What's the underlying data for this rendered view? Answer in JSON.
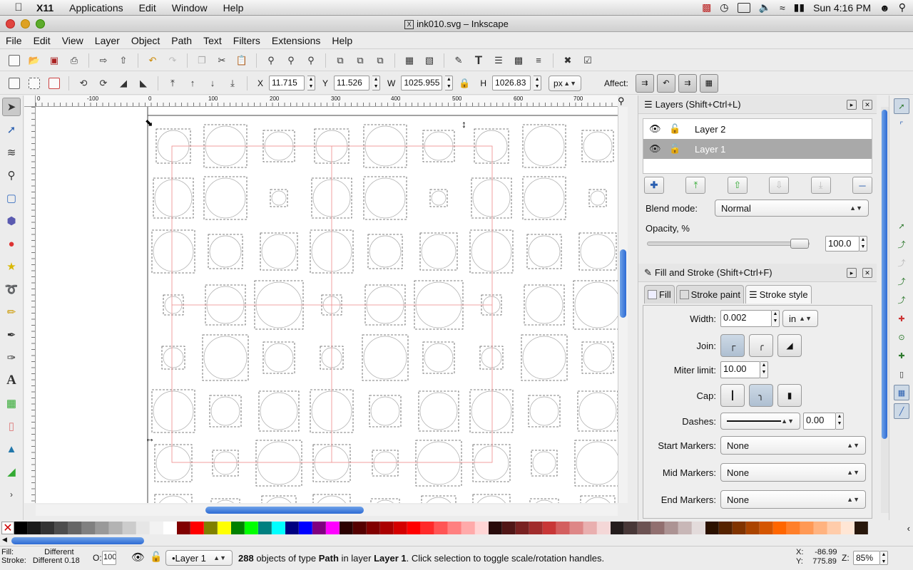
{
  "macbar": {
    "app": "X11",
    "menus": [
      "Applications",
      "Edit",
      "Window",
      "Help"
    ],
    "clock": "Sun 4:16 PM"
  },
  "window": {
    "title": "ink010.svg – Inkscape"
  },
  "menu": [
    "File",
    "Edit",
    "View",
    "Layer",
    "Object",
    "Path",
    "Text",
    "Filters",
    "Extensions",
    "Help"
  ],
  "controls": {
    "x_label": "X",
    "x": "11.715",
    "y_label": "Y",
    "y": "11.526",
    "w_label": "W",
    "w": "1025.955",
    "h_label": "H",
    "h": "1026.83",
    "unit": "px",
    "affect_label": "Affect:"
  },
  "ruler": {
    "h_ticks": [
      "0",
      "-100",
      "0",
      "100",
      "200",
      "300",
      "400",
      "500",
      "600",
      "700"
    ]
  },
  "layers_panel": {
    "title": "Layers (Shift+Ctrl+L)",
    "layers": [
      {
        "name": "Layer 2",
        "selected": false
      },
      {
        "name": "Layer 1",
        "selected": true
      }
    ],
    "blend_label": "Blend mode:",
    "blend_value": "Normal",
    "opacity_label": "Opacity, %",
    "opacity_value": "100.0",
    "opacity_level": 1.0
  },
  "fill_stroke": {
    "title": "Fill and Stroke (Shift+Ctrl+F)",
    "tabs": [
      "Fill",
      "Stroke paint",
      "Stroke style"
    ],
    "active_tab": "Stroke style",
    "width_label": "Width:",
    "width": "0.002",
    "width_unit": "in",
    "join_label": "Join:",
    "miter_label": "Miter limit:",
    "miter": "10.00",
    "cap_label": "Cap:",
    "dashes_label": "Dashes:",
    "dash_offset": "0.00",
    "start_markers_label": "Start Markers:",
    "start_markers": "None",
    "mid_markers_label": "Mid Markers:",
    "mid_markers": "None",
    "end_markers_label": "End Markers:",
    "end_markers": "None"
  },
  "palette": [
    "#000000",
    "#1a1a1a",
    "#333333",
    "#4d4d4d",
    "#666666",
    "#808080",
    "#999999",
    "#b3b3b3",
    "#cccccc",
    "#e6e6e6",
    "#f2f2f2",
    "#ffffff",
    "#800000",
    "#ff0000",
    "#808000",
    "#ffff00",
    "#008000",
    "#00ff00",
    "#008080",
    "#00ffff",
    "#000080",
    "#0000ff",
    "#800080",
    "#ff00ff",
    "#2b0000",
    "#550000",
    "#800000",
    "#aa0000",
    "#d40000",
    "#ff0000",
    "#ff2a2a",
    "#ff5555",
    "#ff8080",
    "#ffaaaa",
    "#ffd5d5",
    "#280b0b",
    "#501616",
    "#782121",
    "#a02c2c",
    "#c83737",
    "#d35f5f",
    "#de8787",
    "#e9afaf",
    "#f4d7d7",
    "#241c1c",
    "#483737",
    "#6c5353",
    "#916f6f",
    "#ac9393",
    "#c8b7b7",
    "#e3dbdb",
    "#2b1100",
    "#552200",
    "#803300",
    "#aa4400",
    "#d45500",
    "#ff6600",
    "#ff7f2a",
    "#ff9955",
    "#ffb380",
    "#ffccaa",
    "#ffe6d5",
    "#28170b"
  ],
  "status": {
    "fill_label": "Fill:",
    "fill_value": "Different",
    "stroke_label": "Stroke:",
    "stroke_value": "Different 0.18",
    "o_label": "O:",
    "o_value": "100",
    "layer": "•Layer 1",
    "message_count": "288",
    "message_rest": " objects of type ",
    "message_type": "Path",
    "message_in": " in layer ",
    "message_layer": "Layer 1",
    "message_tail": ". Click selection to toggle scale/rotation handles.",
    "x_label": "X:",
    "x_value": "-86.99",
    "y_label": "Y:",
    "y_value": "775.89",
    "z_label": "Z:",
    "zoom": "85%"
  }
}
